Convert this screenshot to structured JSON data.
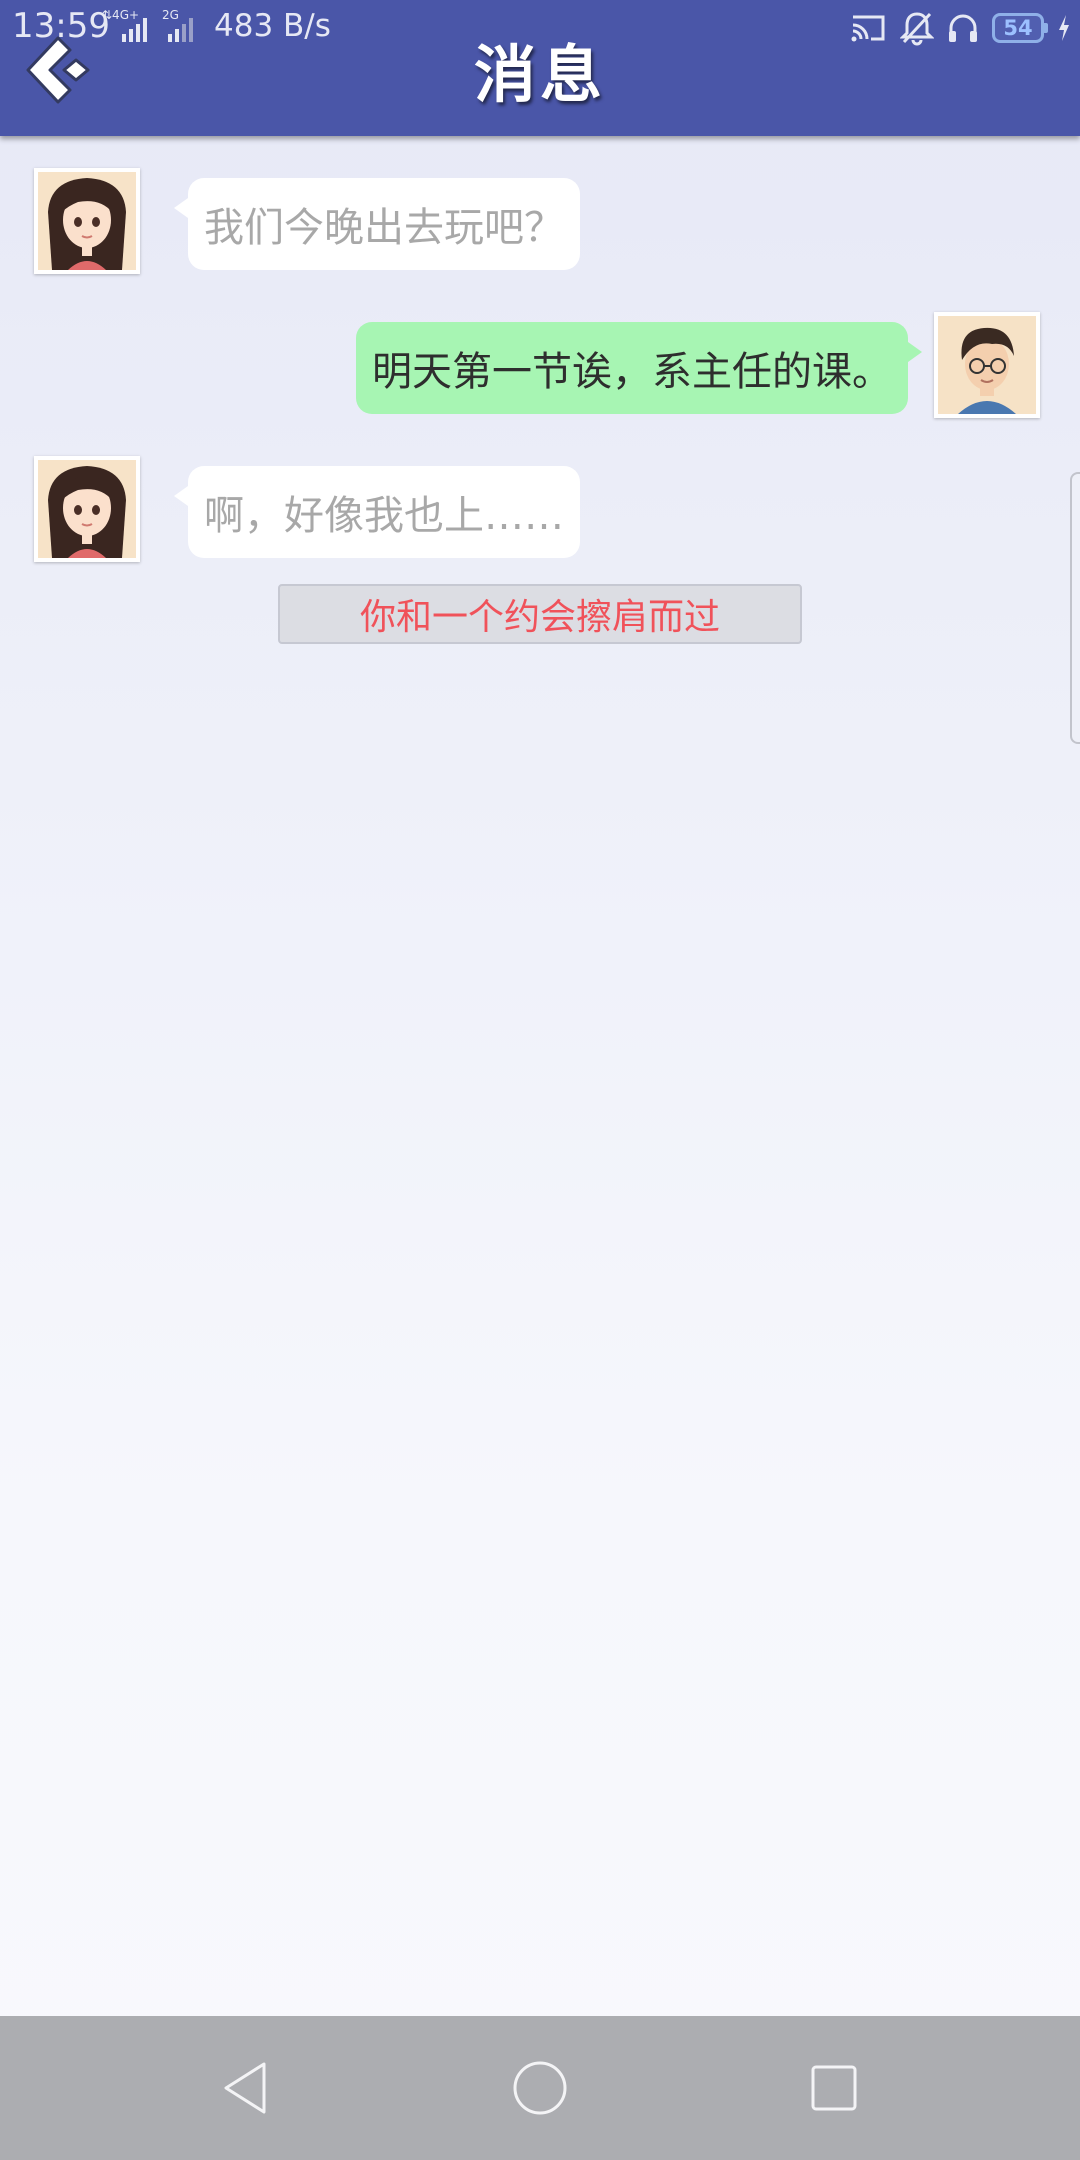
{
  "status_bar": {
    "time": "13:59",
    "network": "4G+ 2G",
    "speed": "483 B/s",
    "battery": "54"
  },
  "header": {
    "title": "消息"
  },
  "messages": [
    {
      "side": "in",
      "sender": "girl",
      "text": "我们今晚出去玩吧？"
    },
    {
      "side": "out",
      "sender": "boy",
      "text": "明天第一节诶，系主任的课。"
    },
    {
      "side": "in",
      "sender": "girl",
      "text": "啊，好像我也上……"
    }
  ],
  "system_notice": "你和一个约会擦肩而过",
  "colors": {
    "header_bg": "#4a56a8",
    "outgoing_bubble": "#a7f5b3",
    "incoming_bubble": "#ffffff",
    "notice_text": "#f0525a"
  },
  "icons": {
    "back": "back-arrow-icon",
    "cast": "cast-icon",
    "mute": "bell-off-icon",
    "headset": "headset-icon",
    "charging": "charging-bolt-icon",
    "nav_back": "triangle-back-icon",
    "nav_home": "circle-home-icon",
    "nav_recent": "square-recent-icon"
  }
}
